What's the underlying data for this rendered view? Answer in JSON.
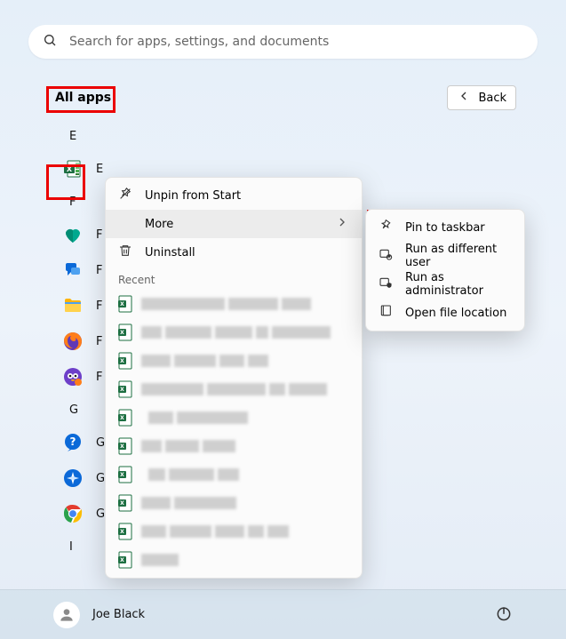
{
  "search": {
    "placeholder": "Search for apps, settings, and documents"
  },
  "header": {
    "all_apps": "All apps",
    "back_label": "Back"
  },
  "letters": {
    "E": "E",
    "F": "F",
    "G": "G",
    "I": "I"
  },
  "apps": {
    "excel": "E",
    "f1": "F",
    "f2": "F",
    "f3": "F",
    "f4": "F",
    "f5": "F",
    "g1": "G",
    "g2": "G",
    "g3": "G"
  },
  "ctx1": {
    "unpin": "Unpin from Start",
    "more": "More",
    "uninstall": "Uninstall",
    "recent_header": "Recent"
  },
  "ctx2": {
    "pin_taskbar": "Pin to taskbar",
    "run_diff_user": "Run as different user",
    "run_admin": "Run as administrator",
    "open_loc": "Open file location"
  },
  "user": {
    "name": "Joe Black"
  },
  "colors": {
    "excel_green": "#1d6f42",
    "heart_teal": "#00a88f",
    "blue": "#0b69d8",
    "folder_yellow": "#ffb300",
    "firefox_orange": "#ff7e1a",
    "purple": "#6d3fc9",
    "chrome": "#ffffff"
  }
}
